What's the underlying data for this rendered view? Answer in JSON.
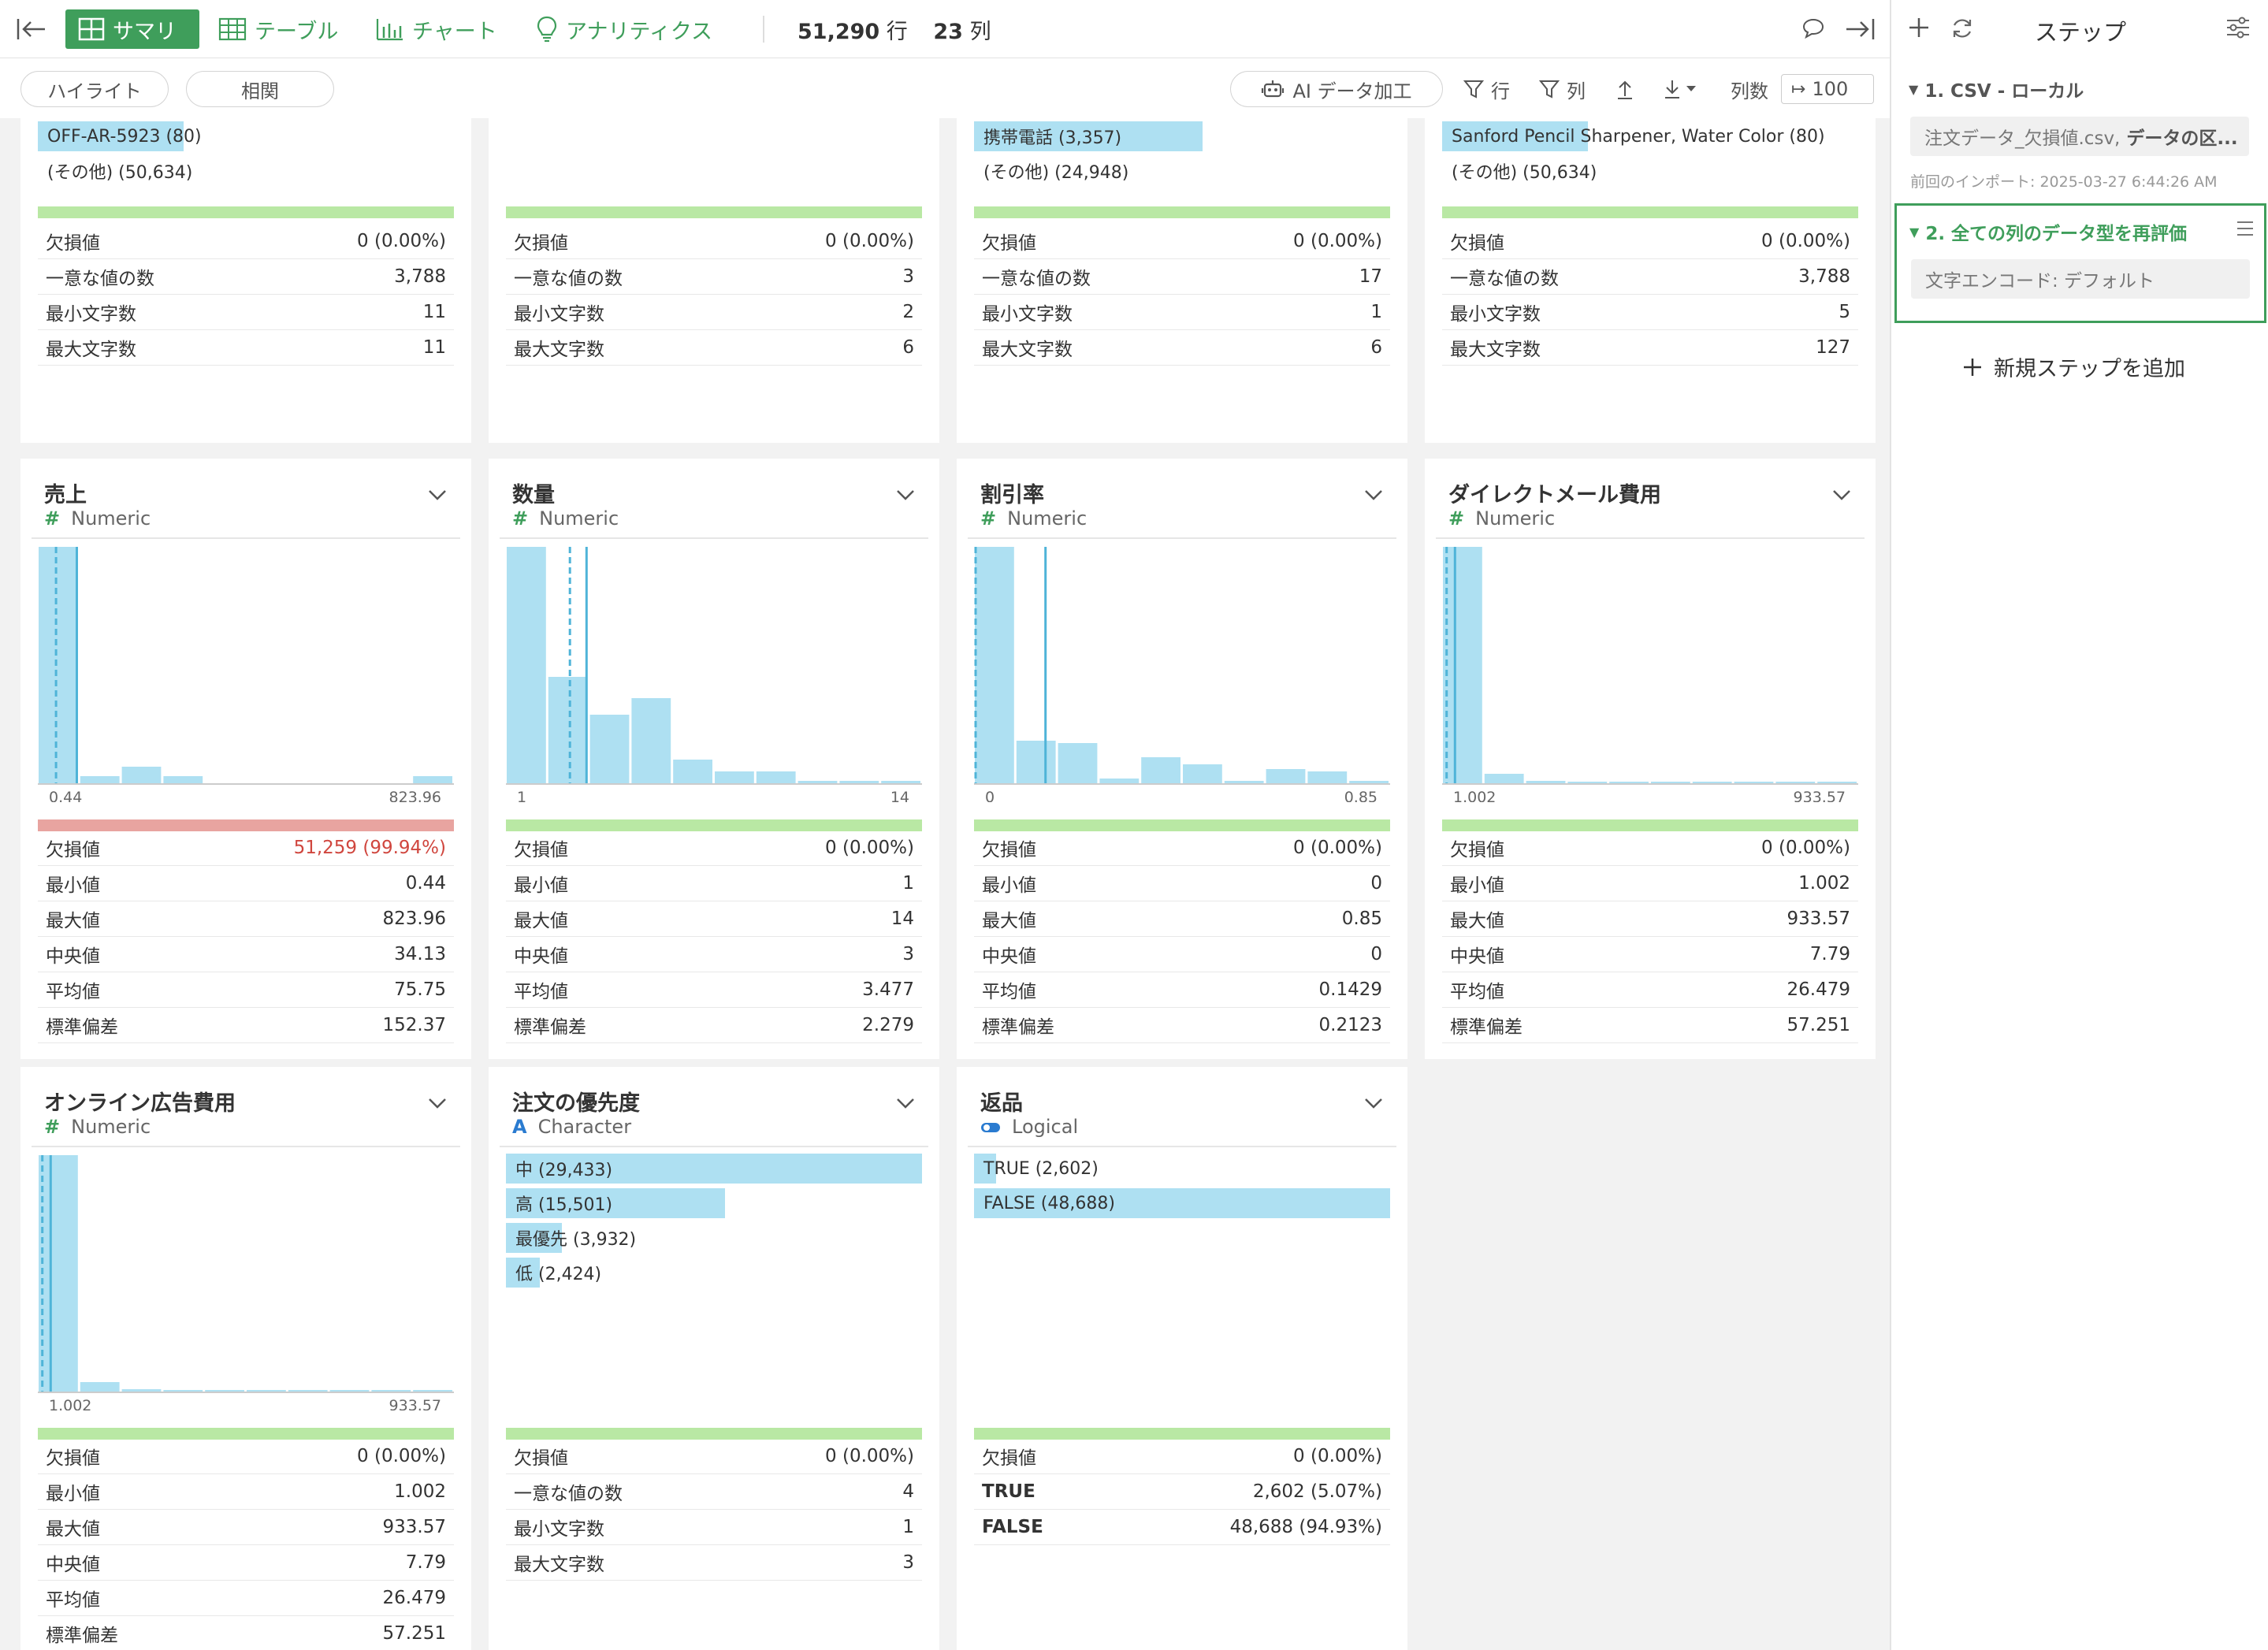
{
  "toolbar": {
    "tabs": [
      {
        "label": "サマリ",
        "icon": "grid-icon"
      },
      {
        "label": "テーブル",
        "icon": "table-icon"
      },
      {
        "label": "チャート",
        "icon": "bar-chart-icon"
      },
      {
        "label": "アナリティクス",
        "icon": "lightbulb-icon"
      }
    ],
    "rows_count": "51,290",
    "rows_unit": "行",
    "cols_count": "23",
    "cols_unit": "列"
  },
  "subbar": {
    "highlight_label": "ハイライト",
    "correlation_label": "相関",
    "ai_label": "AI データ加工",
    "filter_rows_label": "行",
    "filter_cols_label": "列",
    "column_count_label": "列数",
    "column_count_value": "100"
  },
  "top_cards": [
    {
      "bars": [
        {
          "label": "OFF-AR-5923 (80)",
          "fill": 0.35
        },
        {
          "label": "(その他) (50,634)",
          "fill": 0
        }
      ],
      "stats": [
        [
          "欠損値",
          "0 (0.00%)"
        ],
        [
          "一意な値の数",
          "3,788"
        ],
        [
          "最小文字数",
          "11"
        ],
        [
          "最大文字数",
          "11"
        ]
      ]
    },
    {
      "bars": [],
      "stats": [
        [
          "欠損値",
          "0 (0.00%)"
        ],
        [
          "一意な値の数",
          "3"
        ],
        [
          "最小文字数",
          "2"
        ],
        [
          "最大文字数",
          "6"
        ]
      ]
    },
    {
      "bars": [
        {
          "label": "携帯電話 (3,357)",
          "fill": 0.55
        },
        {
          "label": "(その他) (24,948)",
          "fill": 0
        }
      ],
      "stats": [
        [
          "欠損値",
          "0 (0.00%)"
        ],
        [
          "一意な値の数",
          "17"
        ],
        [
          "最小文字数",
          "1"
        ],
        [
          "最大文字数",
          "6"
        ]
      ]
    },
    {
      "bars": [
        {
          "label": "Sanford Pencil Sharpener, Water Color (80)",
          "fill": 0.35
        },
        {
          "label": "(その他) (50,634)",
          "fill": 0
        }
      ],
      "stats": [
        [
          "欠損値",
          "0 (0.00%)"
        ],
        [
          "一意な値の数",
          "3,788"
        ],
        [
          "最小文字数",
          "5"
        ],
        [
          "最大文字数",
          "127"
        ]
      ]
    }
  ],
  "numeric_cards": [
    {
      "title": "売上",
      "type": "Numeric",
      "min_label": "0.44",
      "max_label": "823.96",
      "bins": [
        1.0,
        0.03,
        0.07,
        0.03,
        0,
        0,
        0,
        0,
        0,
        0.03
      ],
      "mean": 0.09,
      "median": 0.04,
      "missing_bad": true,
      "stats": [
        [
          "欠損値",
          "51,259 (99.94%)"
        ],
        [
          "最小値",
          "0.44"
        ],
        [
          "最大値",
          "823.96"
        ],
        [
          "中央値",
          "34.13"
        ],
        [
          "平均値",
          "75.75"
        ],
        [
          "標準偏差",
          "152.37"
        ]
      ]
    },
    {
      "title": "数量",
      "type": "Numeric",
      "min_label": "1",
      "max_label": "14",
      "bins": [
        1.0,
        0.45,
        0.29,
        0.36,
        0.1,
        0.05,
        0.05,
        0.01,
        0.01,
        0.01
      ],
      "mean": 0.19,
      "median": 0.15,
      "missing_bad": false,
      "stats": [
        [
          "欠損値",
          "0 (0.00%)"
        ],
        [
          "最小値",
          "1"
        ],
        [
          "最大値",
          "14"
        ],
        [
          "中央値",
          "3"
        ],
        [
          "平均値",
          "3.477"
        ],
        [
          "標準偏差",
          "2.279"
        ]
      ]
    },
    {
      "title": "割引率",
      "type": "Numeric",
      "min_label": "0",
      "max_label": "0.85",
      "bins": [
        1.0,
        0.18,
        0.17,
        0.02,
        0.11,
        0.08,
        0.01,
        0.06,
        0.05,
        0.01
      ],
      "mean": 0.168,
      "median": 0.0,
      "missing_bad": false,
      "stats": [
        [
          "欠損値",
          "0 (0.00%)"
        ],
        [
          "最小値",
          "0"
        ],
        [
          "最大値",
          "0.85"
        ],
        [
          "中央値",
          "0"
        ],
        [
          "平均値",
          "0.1429"
        ],
        [
          "標準偏差",
          "0.2123"
        ]
      ]
    },
    {
      "title": "ダイレクトメール費用",
      "type": "Numeric",
      "min_label": "1.002",
      "max_label": "933.57",
      "bins": [
        1.0,
        0.04,
        0.01,
        0.005,
        0.005,
        0.003,
        0.003,
        0.002,
        0.002,
        0.002
      ],
      "mean": 0.027,
      "median": 0.007,
      "missing_bad": false,
      "stats": [
        [
          "欠損値",
          "0 (0.00%)"
        ],
        [
          "最小値",
          "1.002"
        ],
        [
          "最大値",
          "933.57"
        ],
        [
          "中央値",
          "7.79"
        ],
        [
          "平均値",
          "26.479"
        ],
        [
          "標準偏差",
          "57.251"
        ]
      ]
    },
    {
      "title": "オンライン広告費用",
      "type": "Numeric",
      "min_label": "1.002",
      "max_label": "933.57",
      "bins": [
        1.0,
        0.04,
        0.01,
        0.005,
        0.005,
        0.003,
        0.003,
        0.002,
        0.002,
        0.002
      ],
      "mean": 0.027,
      "median": 0.007,
      "missing_bad": false,
      "stats": [
        [
          "欠損値",
          "0 (0.00%)"
        ],
        [
          "最小値",
          "1.002"
        ],
        [
          "最大値",
          "933.57"
        ],
        [
          "中央値",
          "7.79"
        ],
        [
          "平均値",
          "26.479"
        ],
        [
          "標準偏差",
          "57.251"
        ]
      ]
    }
  ],
  "priority_card": {
    "title": "注文の優先度",
    "type": "Character",
    "bars": [
      {
        "label": "中 (29,433)",
        "fill": 1.0
      },
      {
        "label": "高 (15,501)",
        "fill": 0.527
      },
      {
        "label": "最優先 (3,932)",
        "fill": 0.134
      },
      {
        "label": "低 (2,424)",
        "fill": 0.082
      }
    ],
    "stats": [
      [
        "欠損値",
        "0 (0.00%)"
      ],
      [
        "一意な値の数",
        "4"
      ],
      [
        "最小文字数",
        "1"
      ],
      [
        "最大文字数",
        "3"
      ]
    ]
  },
  "returns_card": {
    "title": "返品",
    "type": "Logical",
    "bars": [
      {
        "label": "TRUE (2,602)",
        "fill": 0.053
      },
      {
        "label": "FALSE (48,688)",
        "fill": 1.0
      }
    ],
    "stats": [
      [
        "欠損値",
        "0 (0.00%)"
      ],
      [
        "TRUE",
        "2,602 (5.07%)"
      ],
      [
        "FALSE",
        "48,688 (94.93%)"
      ]
    ]
  },
  "right_panel": {
    "title": "ステップ",
    "step1_title": "1. CSV - ローカル",
    "step1_file": "注文データ_欠損値.csv,",
    "step1_file_rest": "データの区...",
    "step1_import": "前回のインポート: 2025-03-27 6:44:26 AM",
    "step2_title": "2. 全ての列のデータ型を再評価",
    "step2_detail": "文字エンコード: デフォルト",
    "add_step_label": "新規ステップを追加"
  },
  "colors": {
    "accent": "#3f9e5b",
    "bar": "#aee0f2",
    "ok": "#b9e8a4",
    "bad": "#e8a4a0",
    "missing_red": "#d0463e"
  }
}
